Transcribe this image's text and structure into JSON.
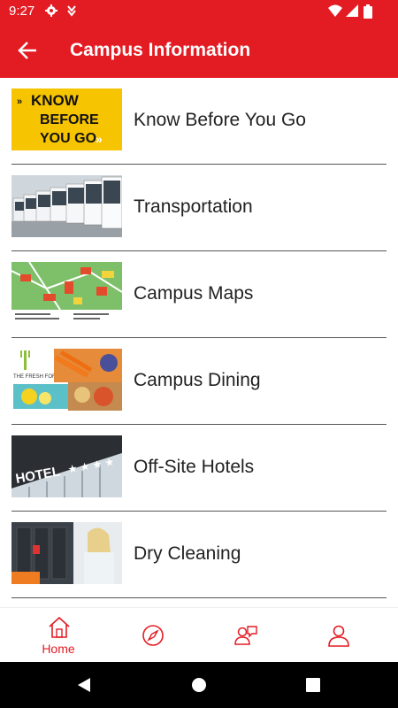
{
  "status_bar": {
    "time": "9:27"
  },
  "app_bar": {
    "title": "Campus Information"
  },
  "items": [
    {
      "label": "Know Before You Go",
      "thumb": {
        "line1": "KNOW",
        "line2": "BEFORE",
        "line3": "YOU GO"
      }
    },
    {
      "label": "Transportation"
    },
    {
      "label": "Campus Maps"
    },
    {
      "label": "Campus Dining",
      "thumb": {
        "brand": "THE FRESH FORK"
      }
    },
    {
      "label": "Off-Site Hotels",
      "thumb": {
        "sign": "HOTEL"
      }
    },
    {
      "label": "Dry Cleaning"
    }
  ],
  "bottom_nav": {
    "home_label": "Home"
  },
  "colors": {
    "brand_red": "#e31b23"
  }
}
